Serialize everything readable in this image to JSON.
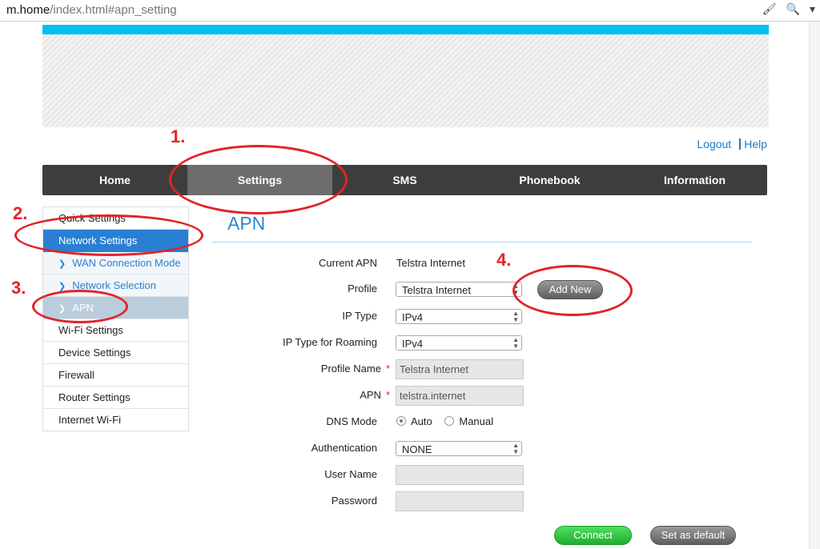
{
  "browser": {
    "url_host": "m.home",
    "url_path": "/index.html#apn_setting"
  },
  "header": {
    "logout": "Logout",
    "help": "Help"
  },
  "nav": [
    "Home",
    "Settings",
    "SMS",
    "Phonebook",
    "Information"
  ],
  "sidebar": {
    "quick_settings": "Quick Settings",
    "network_settings": "Network Settings",
    "wan_connection_mode": "WAN Connection Mode",
    "network_selection": "Network Selection",
    "apn": "APN",
    "wifi_settings": "Wi-Fi Settings",
    "device_settings": "Device Settings",
    "firewall": "Firewall",
    "router_settings": "Router Settings",
    "internet_wifi": "Internet Wi-Fi"
  },
  "page": {
    "title": "APN"
  },
  "form": {
    "current_apn_label": "Current APN",
    "current_apn_value": "Telstra Internet",
    "profile_label": "Profile",
    "profile_value": "Telstra Internet",
    "add_new": "Add New",
    "ip_type_label": "IP Type",
    "ip_type_value": "IPv4",
    "ip_type_roaming_label": "IP Type for Roaming",
    "ip_type_roaming_value": "IPv4",
    "profile_name_label": "Profile Name",
    "profile_name_value": "Telstra Internet",
    "apn_label": "APN",
    "apn_value": "telstra.internet",
    "dns_mode_label": "DNS Mode",
    "dns_auto": "Auto",
    "dns_manual": "Manual",
    "authentication_label": "Authentication",
    "authentication_value": "NONE",
    "user_name_label": "User Name",
    "user_name_value": "",
    "password_label": "Password",
    "password_value": "",
    "required_mark": "*",
    "connect": "Connect",
    "set_default": "Set as default"
  },
  "annotations": [
    "1.",
    "2.",
    "3.",
    "4."
  ],
  "colors": {
    "accent_blue": "#2a7fd3",
    "banner_cyan": "#00bff3",
    "annotation_red": "#e0242a",
    "connect_green": "#2fc23f"
  }
}
